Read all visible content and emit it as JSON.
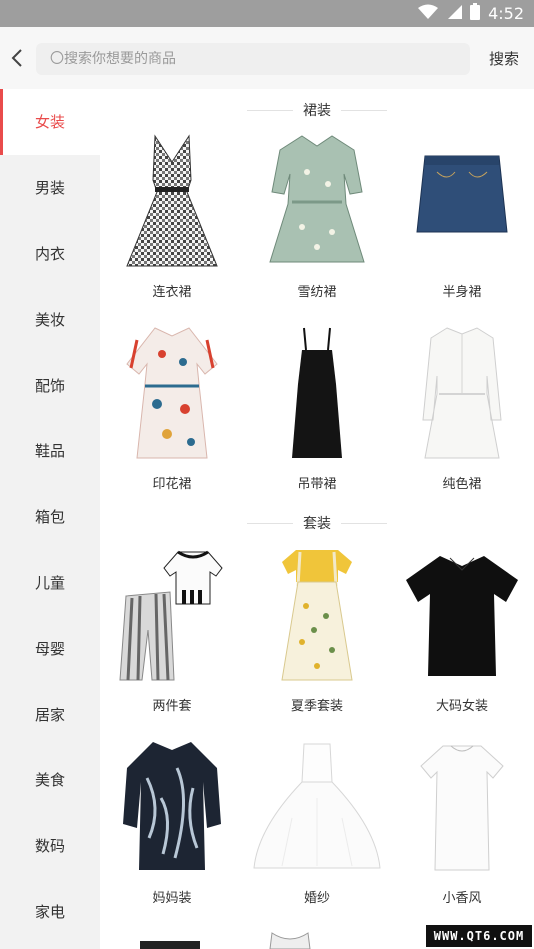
{
  "status_bar": {
    "time": "4:52",
    "icons": [
      "wifi-icon",
      "signal-icon",
      "battery-icon"
    ]
  },
  "top_bar": {
    "back_icon": "chevron-left-icon",
    "search_placeholder": "〇搜索你想要的商品",
    "search_button": "搜索"
  },
  "sidebar": {
    "active_color": "#e94b4b",
    "items": [
      {
        "label": "女装",
        "active": true
      },
      {
        "label": "男装",
        "active": false
      },
      {
        "label": "内衣",
        "active": false
      },
      {
        "label": "美妆",
        "active": false
      },
      {
        "label": "配饰",
        "active": false
      },
      {
        "label": "鞋品",
        "active": false
      },
      {
        "label": "箱包",
        "active": false
      },
      {
        "label": "儿童",
        "active": false
      },
      {
        "label": "母婴",
        "active": false
      },
      {
        "label": "居家",
        "active": false
      },
      {
        "label": "美食",
        "active": false
      },
      {
        "label": "数码",
        "active": false
      },
      {
        "label": "家电",
        "active": false
      }
    ]
  },
  "sections": [
    {
      "title": "裙装",
      "items": [
        {
          "label": "连衣裙",
          "icon": "gingham-dress-image"
        },
        {
          "label": "雪纺裙",
          "icon": "chiffon-dress-image"
        },
        {
          "label": "半身裙",
          "icon": "denim-skirt-image"
        },
        {
          "label": "印花裙",
          "icon": "print-dress-image"
        },
        {
          "label": "吊带裙",
          "icon": "slip-dress-image"
        },
        {
          "label": "纯色裙",
          "icon": "solid-dress-image"
        }
      ]
    },
    {
      "title": "套装",
      "items": [
        {
          "label": "两件套",
          "icon": "two-piece-set-image"
        },
        {
          "label": "夏季套装",
          "icon": "summer-set-image"
        },
        {
          "label": "大码女装",
          "icon": "plus-size-tee-image"
        },
        {
          "label": "妈妈装",
          "icon": "mom-blouse-image"
        },
        {
          "label": "婚纱",
          "icon": "wedding-dress-image"
        },
        {
          "label": "小香风",
          "icon": "chanel-style-dress-image"
        }
      ]
    }
  ],
  "watermark": "WWW.QT6.COM"
}
